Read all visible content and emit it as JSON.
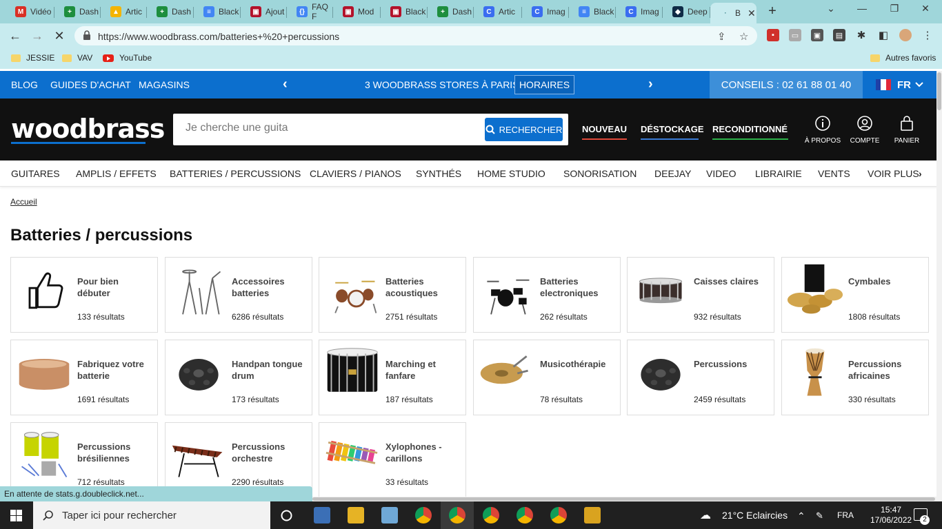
{
  "browser": {
    "tabs": [
      {
        "title": "Vidéo",
        "icon": "gmail-icon",
        "color": "#d93025",
        "glyph": "M"
      },
      {
        "title": "Dash",
        "icon": "sheets-icon",
        "color": "#1e8e3e",
        "glyph": "+"
      },
      {
        "title": "Artic",
        "icon": "drive-icon",
        "color": "#f4b400",
        "glyph": "▲"
      },
      {
        "title": "Dash",
        "icon": "sheets-icon",
        "color": "#1e8e3e",
        "glyph": "+"
      },
      {
        "title": "Black",
        "icon": "docs-icon",
        "color": "#4285f4",
        "glyph": "≡"
      },
      {
        "title": "Ajout",
        "icon": "app-icon",
        "color": "#b3122a",
        "glyph": "▣"
      },
      {
        "title": "FAQ F",
        "icon": "code-icon",
        "color": "#4285f4",
        "glyph": "{}"
      },
      {
        "title": "Mod",
        "icon": "app-icon",
        "color": "#b3122a",
        "glyph": "▣"
      },
      {
        "title": "Black",
        "icon": "app-icon",
        "color": "#b3122a",
        "glyph": "▣"
      },
      {
        "title": "Dash",
        "icon": "sheets-icon",
        "color": "#1e8e3e",
        "glyph": "+"
      },
      {
        "title": "Artic",
        "icon": "c-icon",
        "color": "#3a6df0",
        "glyph": "C"
      },
      {
        "title": "Imag",
        "icon": "c-icon",
        "color": "#3a6df0",
        "glyph": "C"
      },
      {
        "title": "Black",
        "icon": "docs-icon",
        "color": "#4285f4",
        "glyph": "≡"
      },
      {
        "title": "Imag",
        "icon": "c-icon",
        "color": "#3a6df0",
        "glyph": "C"
      },
      {
        "title": "Deep",
        "icon": "deepl-icon",
        "color": "#0f2b46",
        "glyph": "◆"
      },
      {
        "title": "B",
        "icon": "loading-icon",
        "color": "#c8ebef",
        "glyph": "·"
      }
    ],
    "url": "https://www.woodbrass.com/batteries+%20+percussions",
    "bookmarks": [
      "JESSIE",
      "VAV",
      "YouTube"
    ],
    "other_bookmarks": "Autres favoris",
    "status": "En attente de stats.g.doubleclick.net..."
  },
  "topbar": {
    "links": [
      "BLOG",
      "GUIDES D'ACHAT",
      "MAGASINS"
    ],
    "promo": "3 WOODBRASS STORES À PARIS !",
    "horaires": "HORAIRES",
    "conseils": "CONSEILS : 02 61 88 01 40",
    "lang": "FR"
  },
  "header": {
    "logo": "woodbrass",
    "search_placeholder": "Je cherche une guita",
    "search_button": "RECHERCHER",
    "links": [
      {
        "label": "NOUVEAU",
        "color": "#e24a3b"
      },
      {
        "label": "DÉSTOCKAGE",
        "color": "#3a7bd5"
      },
      {
        "label": "RECONDITIONNÉ",
        "color": "#2db34a"
      }
    ],
    "icons": [
      "À PROPOS",
      "COMPTE",
      "PANIER"
    ]
  },
  "categories": [
    "GUITARES",
    "AMPLIS / EFFETS",
    "BATTERIES / PERCUSSIONS",
    "CLAVIERS / PIANOS",
    "SYNTHÉS",
    "HOME STUDIO",
    "SONORISATION",
    "DEEJAY",
    "VIDEO",
    "LIBRAIRIE",
    "VENTS",
    "VOIR PLUS"
  ],
  "breadcrumb": "Accueil",
  "page_title": "Batteries / percussions",
  "cards": [
    {
      "name": "Pour bien débuter",
      "count": "133 résultats",
      "icon": "thumbs-up-icon"
    },
    {
      "name": "Accessoires batteries",
      "count": "6286 résultats",
      "icon": "drum-stands-icon"
    },
    {
      "name": "Batteries acoustiques",
      "count": "2751 résultats",
      "icon": "acoustic-drum-kit-icon"
    },
    {
      "name": "Batteries electroniques",
      "count": "262 résultats",
      "icon": "electronic-drum-kit-icon"
    },
    {
      "name": "Caisses claires",
      "count": "932 résultats",
      "icon": "snare-drum-icon"
    },
    {
      "name": "Cymbales",
      "count": "1808 résultats",
      "icon": "cymbals-icon"
    },
    {
      "name": "Fabriquez votre batterie",
      "count": "1691 résultats",
      "icon": "drum-shell-icon"
    },
    {
      "name": "Handpan tongue drum",
      "count": "173 résultats",
      "icon": "handpan-icon"
    },
    {
      "name": "Marching et fanfare",
      "count": "187 résultats",
      "icon": "marching-drum-icon"
    },
    {
      "name": "Musicothérapie",
      "count": "78 résultats",
      "icon": "gong-icon"
    },
    {
      "name": "Percussions",
      "count": "2459 résultats",
      "icon": "handpan-icon"
    },
    {
      "name": "Percussions africaines",
      "count": "330 résultats",
      "icon": "djembe-icon"
    },
    {
      "name": "Percussions brésiliennes",
      "count": "712 résultats",
      "icon": "surdo-icon"
    },
    {
      "name": "Percussions orchestre",
      "count": "2290 résultats",
      "icon": "xylophone-icon"
    },
    {
      "name": "Xylophones - carillons",
      "count": "33 résultats",
      "icon": "toy-xylophone-icon"
    }
  ],
  "taskbar": {
    "search": "Taper ici pour rechercher",
    "weather": "21°C Eclaircies",
    "lang": "FRA",
    "time": "15:47",
    "date": "17/06/2022",
    "notifications": "2"
  }
}
